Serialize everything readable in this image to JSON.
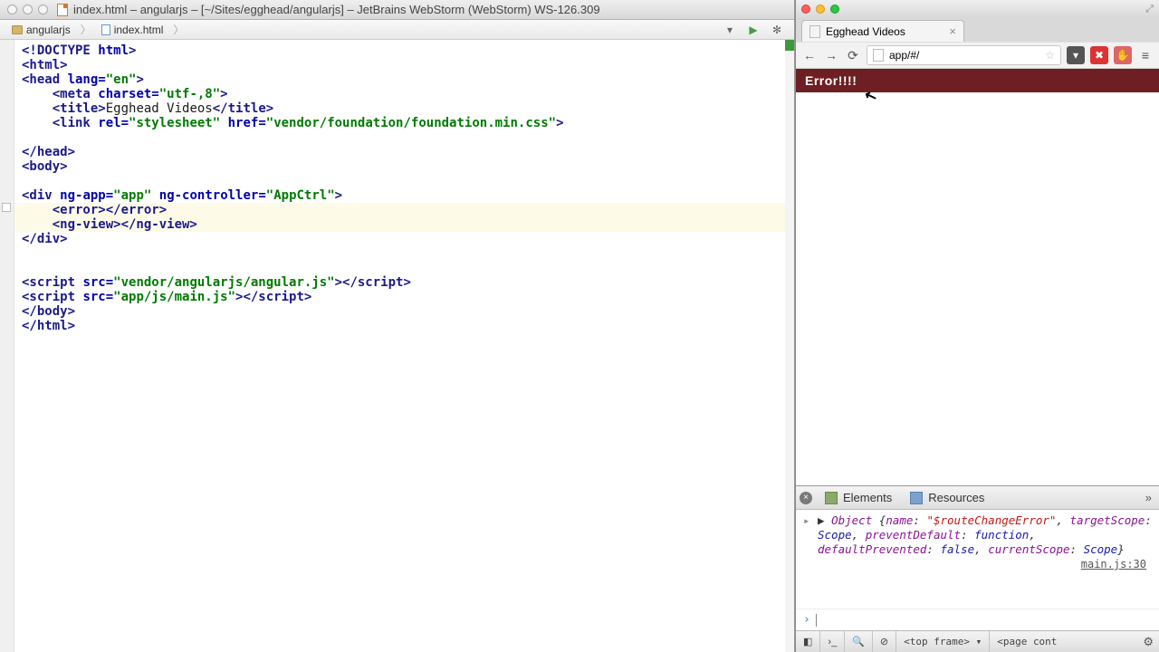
{
  "ide": {
    "title": "index.html – angularjs – [~/Sites/egghead/angularjs] – JetBrains WebStorm (WebStorm) WS-126.309",
    "breadcrumbs": [
      "angularjs",
      "index.html"
    ],
    "toolbar_icons": [
      "dropdown",
      "run",
      "gear"
    ]
  },
  "code": {
    "lines": [
      {
        "t": [
          [
            "tag",
            "<!DOCTYPE "
          ],
          [
            "attr",
            "html"
          ],
          [
            "tag",
            ">"
          ]
        ]
      },
      {
        "t": [
          [
            "tag",
            "<html>"
          ]
        ]
      },
      {
        "t": [
          [
            "tag",
            "<head "
          ],
          [
            "attr",
            "lang="
          ],
          [
            "str",
            "\"en\""
          ],
          [
            "tag",
            ">"
          ]
        ]
      },
      {
        "i": 1,
        "t": [
          [
            "tag",
            "<meta "
          ],
          [
            "attr",
            "charset="
          ],
          [
            "str",
            "\"utf-,8\""
          ],
          [
            "tag",
            ">"
          ]
        ]
      },
      {
        "i": 1,
        "t": [
          [
            "tag",
            "<title>"
          ],
          [
            "txt",
            "Egghead Videos"
          ],
          [
            "tag",
            "</title>"
          ]
        ]
      },
      {
        "i": 1,
        "t": [
          [
            "tag",
            "<link "
          ],
          [
            "attr",
            "rel="
          ],
          [
            "str",
            "\"stylesheet\""
          ],
          [
            "txt",
            " "
          ],
          [
            "attr",
            "href="
          ],
          [
            "str",
            "\"vendor/foundation/foundation.min.css\""
          ],
          [
            "tag",
            ">"
          ]
        ]
      },
      {
        "t": []
      },
      {
        "t": [
          [
            "tag",
            "</head>"
          ]
        ]
      },
      {
        "t": [
          [
            "tag",
            "<body>"
          ]
        ]
      },
      {
        "t": []
      },
      {
        "t": [
          [
            "tag",
            "<div "
          ],
          [
            "attr",
            "ng-app="
          ],
          [
            "str",
            "\"app\""
          ],
          [
            "txt",
            " "
          ],
          [
            "attr",
            "ng-controller="
          ],
          [
            "str",
            "\"AppCtrl\""
          ],
          [
            "tag",
            ">"
          ]
        ]
      },
      {
        "i": 1,
        "t": [
          [
            "tag",
            "<error></error>"
          ]
        ]
      },
      {
        "i": 1,
        "t": [
          [
            "tag",
            "<ng-view></ng-view>"
          ]
        ]
      },
      {
        "t": [
          [
            "tag",
            "</div>"
          ]
        ]
      },
      {
        "t": []
      },
      {
        "t": []
      },
      {
        "t": [
          [
            "tag",
            "<script "
          ],
          [
            "attr",
            "src="
          ],
          [
            "str",
            "\"vendor/angularjs/angular.js\""
          ],
          [
            "tag",
            "></script>"
          ]
        ]
      },
      {
        "t": [
          [
            "tag",
            "<script "
          ],
          [
            "attr",
            "src="
          ],
          [
            "str",
            "\"app/js/main.js\""
          ],
          [
            "tag",
            "></script>"
          ]
        ]
      },
      {
        "t": [
          [
            "tag",
            "</body>"
          ]
        ]
      },
      {
        "t": [
          [
            "tag",
            "</html>"
          ]
        ]
      }
    ]
  },
  "browser": {
    "tab_title": "Egghead Videos",
    "url": "app/#/",
    "error_text": "Error!!!!"
  },
  "devtools": {
    "tabs": [
      "Elements",
      "Resources"
    ],
    "console_tokens": [
      [
        "txt",
        "▶ "
      ],
      [
        "kw",
        "Object "
      ],
      [
        "txt",
        "{"
      ],
      [
        "prop",
        "name"
      ],
      [
        "txt",
        ": "
      ],
      [
        "str",
        "\"$routeChangeError\""
      ],
      [
        "txt",
        ", "
      ],
      [
        "prop",
        "targetScope"
      ],
      [
        "txt",
        ": "
      ],
      [
        "val",
        "Scope"
      ],
      [
        "txt",
        ", "
      ],
      [
        "prop",
        "preventDefault"
      ],
      [
        "txt",
        ": "
      ],
      [
        "val",
        "function"
      ],
      [
        "txt",
        ", "
      ],
      [
        "prop",
        "defaultPrevented"
      ],
      [
        "txt",
        ": "
      ],
      [
        "val",
        "false"
      ],
      [
        "txt",
        ", "
      ],
      [
        "prop",
        "currentScope"
      ],
      [
        "txt",
        ": "
      ],
      [
        "val",
        "Scope"
      ],
      [
        "txt",
        "}"
      ]
    ],
    "source_link": "main.js:30",
    "bottom": {
      "frame_sel": "<top frame> ▾",
      "context_sel": "<page cont"
    }
  }
}
